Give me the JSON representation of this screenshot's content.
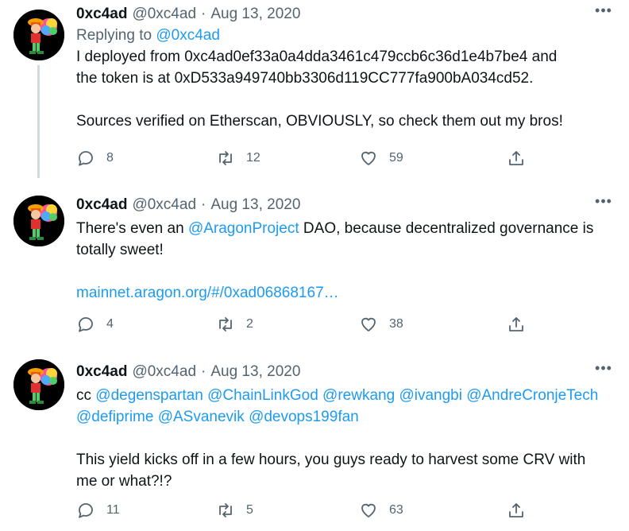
{
  "tweets": [
    {
      "name": "0xc4ad",
      "handle": "@0xc4ad",
      "date": "Aug 13, 2020",
      "replying_prefix": "Replying to ",
      "replying_to": "@0xc4ad",
      "line1": "I deployed from 0xc4ad0ef33a0a4dda3461c479ccb6c36d1e4b7be4 and",
      "line2": "the token is at 0xD533a949740bb3306d119CC777fa900bA034cd52.",
      "line3": "Sources verified on Etherscan, OBVIOUSLY, so check them out my bros!",
      "replies": "8",
      "retweets": "12",
      "likes": "59"
    },
    {
      "name": "0xc4ad",
      "handle": "@0xc4ad",
      "date": "Aug 13, 2020",
      "text_pre": "There's even an ",
      "mention": "@AragonProject",
      "text_post": " DAO, because decentralized governance is",
      "line2": "totally sweet!",
      "url": "mainnet.aragon.org/#/0xad06868167…",
      "replies": "4",
      "retweets": "2",
      "likes": "38"
    },
    {
      "name": "0xc4ad",
      "handle": "@0xc4ad",
      "date": "Aug 13, 2020",
      "cc": "cc ",
      "mentions_line1": [
        "@degenspartan",
        "@ChainLinkGod",
        "@rewkang",
        "@ivangbi",
        "@AndreCronjeTech"
      ],
      "mentions_line2": [
        "@defiprime",
        "@ASvanevik",
        "@devops199fan"
      ],
      "line3": "This yield kicks off in a few hours, you guys ready to harvest some CRV with",
      "line4": "me or what?!?",
      "replies": "11",
      "retweets": "5",
      "likes": "63"
    }
  ],
  "icons": {
    "more": "more-dots-icon",
    "reply": "reply-bubble-icon",
    "retweet": "retweet-arrows-icon",
    "like": "heart-icon",
    "share": "share-upload-icon"
  },
  "colors": {
    "link": "#1d9bf0",
    "secondary": "#536471",
    "thread_line": "#cfd9de"
  },
  "more_glyph": "•••"
}
